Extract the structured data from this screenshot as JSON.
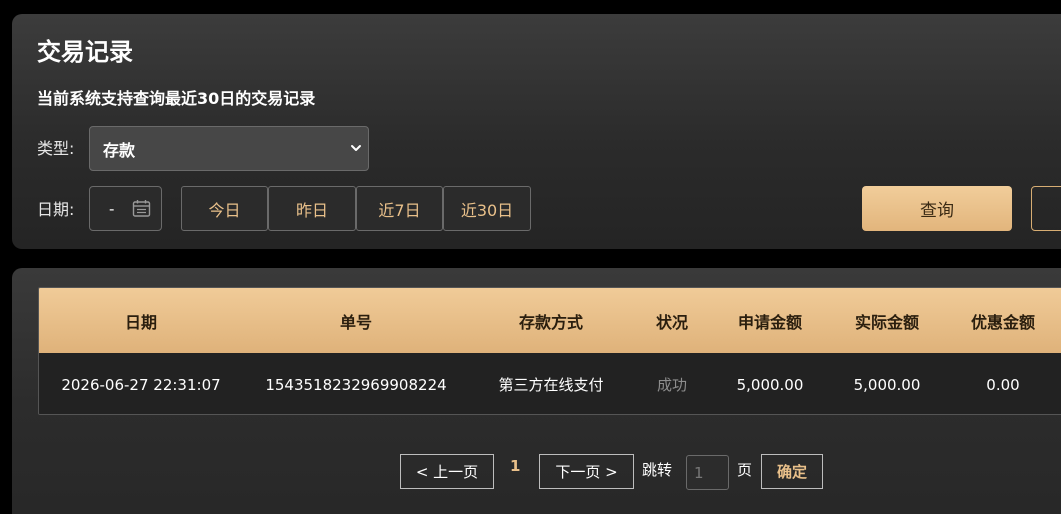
{
  "header": {
    "title": "交易记录",
    "subtitle": "当前系统支持查询最近30日的交易记录"
  },
  "filters": {
    "type_label": "类型:",
    "type_value": "存款",
    "date_label": "日期:",
    "date_value": "-",
    "quick_ranges": [
      "今日",
      "昨日",
      "近7日",
      "近30日"
    ],
    "query_label": "查询"
  },
  "table": {
    "columns": [
      "日期",
      "单号",
      "存款方式",
      "状况",
      "申请金额",
      "实际金额",
      "优惠金额"
    ],
    "rows": [
      {
        "date": "2026-06-27 22:31:07",
        "order_no": "1543518232969908224",
        "method": "第三方在线支付",
        "status": "成功",
        "requested_amount": "5,000.00",
        "actual_amount": "5,000.00",
        "bonus_amount": "0.00"
      }
    ]
  },
  "pagination": {
    "prev_label": "< 上一页",
    "current_page": "1",
    "next_label": "下一页 >",
    "jump_label": "跳转",
    "page_input_placeholder": "1",
    "page_unit": "页",
    "confirm_label": "确定"
  },
  "colors": {
    "accent_gold": "#e9c08a",
    "button_gold_top": "#f1cd9a",
    "button_gold_bottom": "#e2b57c",
    "panel_bg": "#2b2b2b",
    "status_success": "#8d8d8d"
  }
}
